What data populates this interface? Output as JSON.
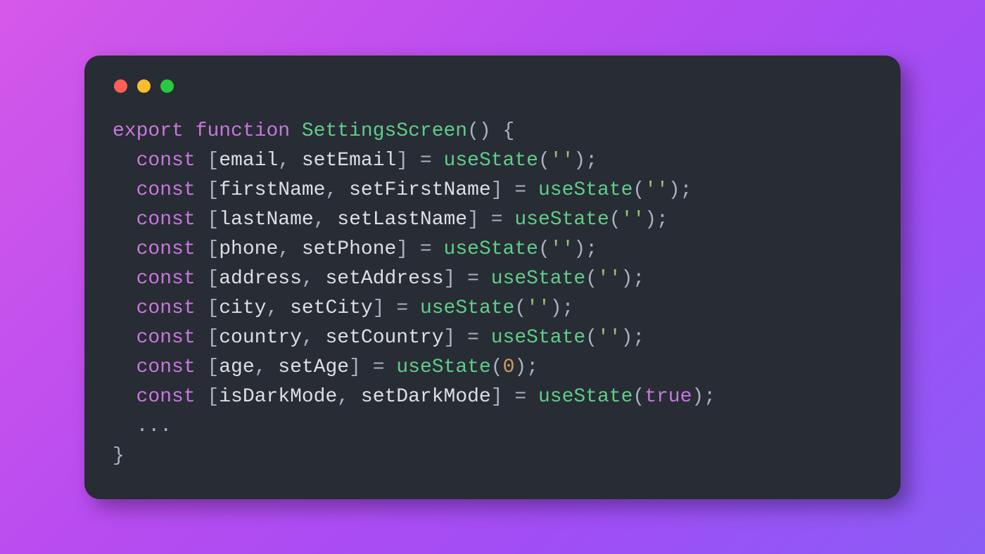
{
  "window": {
    "dots": [
      "red",
      "yellow",
      "green"
    ]
  },
  "code": {
    "line1": {
      "export": "export",
      "function": "function",
      "name": "SettingsScreen",
      "parens": "()",
      "brace": "{"
    },
    "states": [
      {
        "const": "const",
        "lb": "[",
        "var": "email",
        "comma": ", ",
        "setter": "setEmail",
        "rb": "]",
        "eq": " = ",
        "call": "useState",
        "lp": "(",
        "arg": "''",
        "argType": "str",
        "rp": ")",
        "semi": ";"
      },
      {
        "const": "const",
        "lb": "[",
        "var": "firstName",
        "comma": ", ",
        "setter": "setFirstName",
        "rb": "]",
        "eq": " = ",
        "call": "useState",
        "lp": "(",
        "arg": "''",
        "argType": "str",
        "rp": ")",
        "semi": ";"
      },
      {
        "const": "const",
        "lb": "[",
        "var": "lastName",
        "comma": ", ",
        "setter": "setLastName",
        "rb": "]",
        "eq": " = ",
        "call": "useState",
        "lp": "(",
        "arg": "''",
        "argType": "str",
        "rp": ")",
        "semi": ";"
      },
      {
        "const": "const",
        "lb": "[",
        "var": "phone",
        "comma": ", ",
        "setter": "setPhone",
        "rb": "]",
        "eq": " = ",
        "call": "useState",
        "lp": "(",
        "arg": "''",
        "argType": "str",
        "rp": ")",
        "semi": ";"
      },
      {
        "const": "const",
        "lb": "[",
        "var": "address",
        "comma": ", ",
        "setter": "setAddress",
        "rb": "]",
        "eq": " = ",
        "call": "useState",
        "lp": "(",
        "arg": "''",
        "argType": "str",
        "rp": ")",
        "semi": ";"
      },
      {
        "const": "const",
        "lb": "[",
        "var": "city",
        "comma": ", ",
        "setter": "setCity",
        "rb": "]",
        "eq": " = ",
        "call": "useState",
        "lp": "(",
        "arg": "''",
        "argType": "str",
        "rp": ")",
        "semi": ";"
      },
      {
        "const": "const",
        "lb": "[",
        "var": "country",
        "comma": ", ",
        "setter": "setCountry",
        "rb": "]",
        "eq": " = ",
        "call": "useState",
        "lp": "(",
        "arg": "''",
        "argType": "str",
        "rp": ")",
        "semi": ";"
      },
      {
        "const": "const",
        "lb": "[",
        "var": "age",
        "comma": ", ",
        "setter": "setAge",
        "rb": "]",
        "eq": " = ",
        "call": "useState",
        "lp": "(",
        "arg": "0",
        "argType": "num",
        "rp": ")",
        "semi": ";"
      },
      {
        "const": "const",
        "lb": "[",
        "var": "isDarkMode",
        "comma": ", ",
        "setter": "setDarkMode",
        "rb": "]",
        "eq": " = ",
        "call": "useState",
        "lp": "(",
        "arg": "true",
        "argType": "bool",
        "rp": ")",
        "semi": ";"
      }
    ],
    "ellipsis": "...",
    "closeBrace": "}"
  }
}
